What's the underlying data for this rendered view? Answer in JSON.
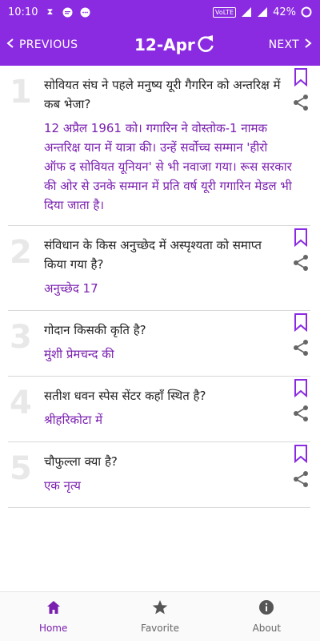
{
  "status_bar": {
    "time": "10:10",
    "network_label": "VoLTE",
    "battery": "42%"
  },
  "app_bar": {
    "prev_label": "PREVIOUS",
    "next_label": "NEXT",
    "date": "12-Apr",
    "icons": [
      "chevron-left-icon",
      "refresh-icon",
      "chevron-right-icon"
    ]
  },
  "questions": [
    {
      "number": "1",
      "question": "सोवियत संघ ने पहले मनुष्य यूरी गैगरिन को अन्तरिक्ष में कब भेजा?",
      "answer": "12 अप्रैल 1961 को। गगारिन ने वोस्तोक-1 नामक अन्तरिक्ष यान में यात्रा की। उन्हें सर्वोच्च सम्मान 'हीरो ऑफ द सोवियत यूनियन' से भी नवाजा गया। रूस सरकार की ओर से उनके सम्मान में प्रति वर्ष यूरी गगारिन मेडल भी दिया जाता है।"
    },
    {
      "number": "2",
      "question": "संविधान के किस अनुच्छेद में अस्पृश्यता को समाप्त किया गया है?",
      "answer": "अनुच्छेद 17"
    },
    {
      "number": "3",
      "question": "गोदान किसकी कृति है?",
      "answer": "मुंशी प्रेमचन्द की"
    },
    {
      "number": "4",
      "question": "सतीश धवन स्पेस सेंटर कहाँ स्थित है?",
      "answer": "श्रीहरिकोटा में"
    },
    {
      "number": "5",
      "question": "चौफुल्ला   क्या है?",
      "answer": "एक नृत्य"
    }
  ],
  "bottom_nav": {
    "home_label": "Home",
    "favorite_label": "Favorite",
    "about_label": "About"
  },
  "colors": {
    "primary": "#8a2be2",
    "answer": "#7a1fb0"
  }
}
